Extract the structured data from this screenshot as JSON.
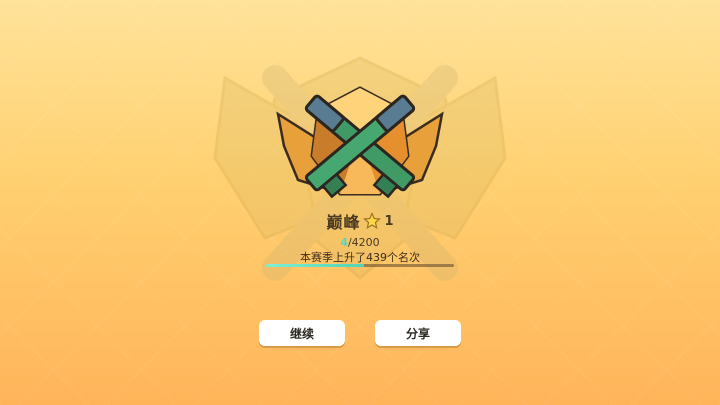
{
  "rank": {
    "name": "巅峰",
    "stars": 1,
    "star_icon": "star-icon"
  },
  "progress": {
    "current": "4",
    "max": "/4200",
    "fraction": 0.52
  },
  "rank_change_text": "本赛季上升了439个名次",
  "buttons": {
    "continue_label": "继续",
    "share_label": "分享"
  },
  "colors": {
    "background_top": "#ffe39a",
    "background_bottom": "#ffb45a",
    "progress_fill": "#55d3b3",
    "gun_green": "#3f9a66",
    "gem_orange": "#f0a43c"
  }
}
